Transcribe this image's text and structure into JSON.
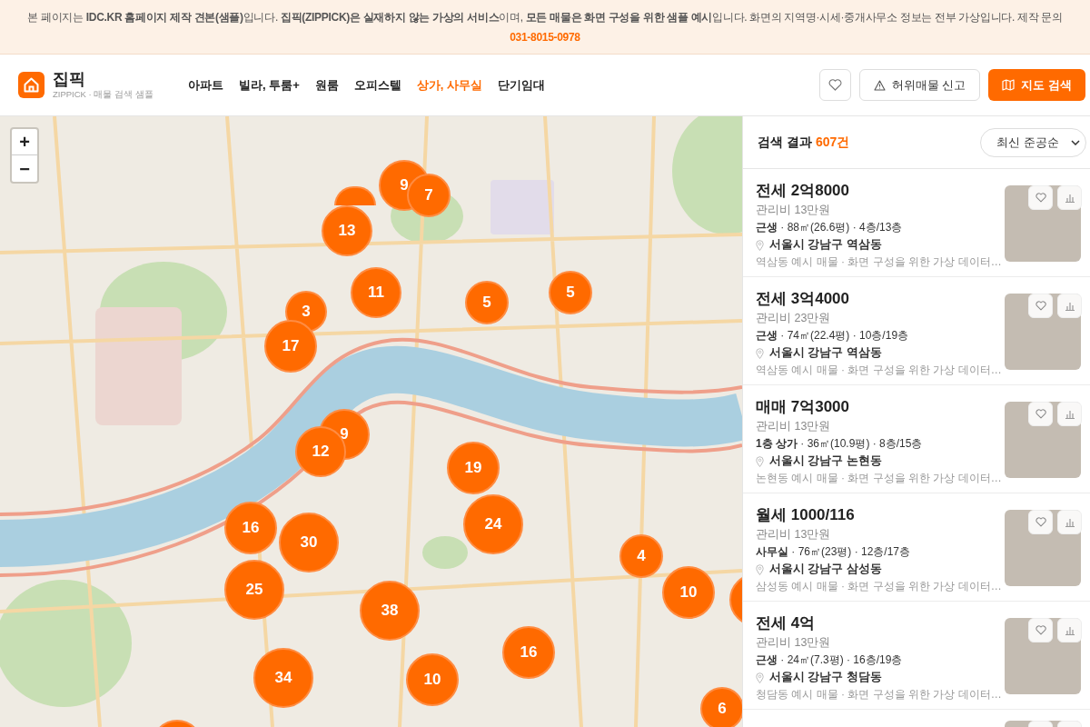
{
  "banner": {
    "text": "본 페이지는 **IDC.KR 홈페이지 제작 견본(샘플)**입니다. **집픽(ZIPPICK)은 실재하지 않는 가상의 서비스**이며, **모든 매물은 화면 구성을 위한 샘플 예시**입니다. 화면의 지역명·시세·중개사무소 정보는 전부 가상입니다. 제작 문의",
    "contact": "031-8015-0978"
  },
  "header": {
    "logo": {
      "name": "집픽",
      "tagline": "ZIPPICK · 매물 검색 샘플"
    },
    "nav": [
      {
        "label": "아파트",
        "selected": false
      },
      {
        "label": "빌라, 투룸+",
        "selected": false
      },
      {
        "label": "원룸",
        "selected": false
      },
      {
        "label": "오피스텔",
        "selected": false
      },
      {
        "label": "상가, 사무실",
        "selected": true
      },
      {
        "label": "단기임대",
        "selected": false
      }
    ],
    "report_button": "허위매물 신고",
    "map_search_button": "지도 검색"
  },
  "map": {
    "zoom_in": "+",
    "zoom_out": "−",
    "clusters": [
      {
        "kind": "peek"
      },
      {
        "kind": "count",
        "count": "9"
      },
      {
        "kind": "count",
        "count": "7"
      },
      {
        "kind": "count",
        "count": "13"
      },
      {
        "kind": "count",
        "count": "11"
      },
      {
        "kind": "count",
        "count": "5"
      },
      {
        "kind": "count",
        "count": "5"
      },
      {
        "kind": "count",
        "count": "3"
      },
      {
        "kind": "count",
        "count": "17"
      },
      {
        "kind": "count",
        "count": "9"
      },
      {
        "kind": "count",
        "count": "12"
      },
      {
        "kind": "count",
        "count": "19"
      },
      {
        "kind": "count",
        "count": "24"
      },
      {
        "kind": "count",
        "count": "16"
      },
      {
        "kind": "count",
        "count": "30"
      },
      {
        "kind": "count",
        "count": "4"
      },
      {
        "kind": "count",
        "count": "25"
      },
      {
        "kind": "count",
        "count": "10"
      },
      {
        "kind": "blank"
      },
      {
        "kind": "count",
        "count": "38"
      },
      {
        "kind": "count",
        "count": "16"
      },
      {
        "kind": "count",
        "count": "34"
      },
      {
        "kind": "count",
        "count": "10"
      },
      {
        "kind": "count",
        "count": "6"
      },
      {
        "kind": "blank"
      }
    ]
  },
  "results": {
    "label": "검색 결과",
    "count": "607건",
    "sort": "최신 준공순",
    "listings": [
      {
        "price": "전세 2억8000",
        "fee": "관리비 13만원",
        "spec": "**근생** · 88㎡(26.6평) · 4층/13층",
        "location": "서울시 강남구 역삼동",
        "description": "역삼동 예시 매물 · 화면 구성을 위한 가상 데이터…"
      },
      {
        "price": "전세 3억4000",
        "fee": "관리비 23만원",
        "spec": "**근생** · 74㎡(22.4평) · 10층/19층",
        "location": "서울시 강남구 역삼동",
        "description": "역삼동 예시 매물 · 화면 구성을 위한 가상 데이터…"
      },
      {
        "price": "매매 7억3000",
        "fee": "관리비 13만원",
        "spec": "**1층 상가** · 36㎡(10.9평) · 8층/15층",
        "location": "서울시 강남구 논현동",
        "description": "논현동 예시 매물 · 화면 구성을 위한 가상 데이터…"
      },
      {
        "price": "월세 1000/116",
        "fee": "관리비 13만원",
        "spec": "**사무실** · 76㎡(23평) · 12층/17층",
        "location": "서울시 강남구 삼성동",
        "description": "삼성동 예시 매물 · 화면 구성을 위한 가상 데이터…"
      },
      {
        "price": "전세 4억",
        "fee": "관리비 13만원",
        "spec": "**근생** · 24㎡(7.3평) · 16층/19층",
        "location": "서울시 강남구 청담동",
        "description": "청담동 예시 매물 · 화면 구성을 위한 가상 데이터…"
      }
    ],
    "next_listing_peek": true
  }
}
